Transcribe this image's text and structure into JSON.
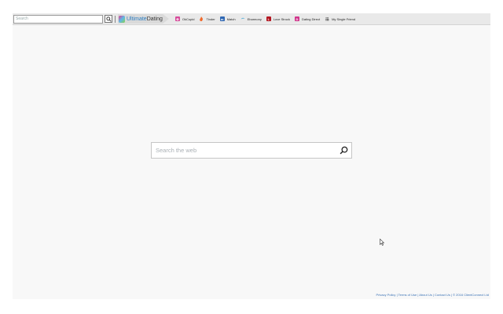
{
  "toolbar": {
    "search_placeholder": "Search",
    "brand": {
      "part1": "Ultimate",
      "part2": "Dating"
    },
    "links": [
      {
        "label": "OkCupid",
        "icon": "okcupid-icon",
        "color": "#d64a9a"
      },
      {
        "label": "Tinder",
        "icon": "tinder-flame-icon",
        "color": "#f06a2c"
      },
      {
        "label": "Match",
        "icon": "match-icon",
        "color": "#2f67b3"
      },
      {
        "label": "Eharmony",
        "icon": "eharmony-icon",
        "color": "#45a9d8"
      },
      {
        "label": "Love Struck",
        "icon": "lovestruck-icon",
        "color": "#b3141f"
      },
      {
        "label": "Dating Direct",
        "icon": "datingdirect-icon",
        "color": "#d0338b"
      },
      {
        "label": "My Single Friend",
        "icon": "mysinglefriend-icon",
        "color": "#9a9a9a"
      }
    ]
  },
  "main_search": {
    "placeholder": "Search the web"
  },
  "footer": {
    "privacy": "Privacy Policy",
    "terms": "Terms of Use",
    "about": "About Us",
    "contact": "Contact Us",
    "copyright": "© 2016 ClientConnect Ltd"
  },
  "colors": {
    "page_bg": "#f8f8f8",
    "toolbar_bg": "#e9e9e9",
    "link_blue": "#3a72b5"
  }
}
